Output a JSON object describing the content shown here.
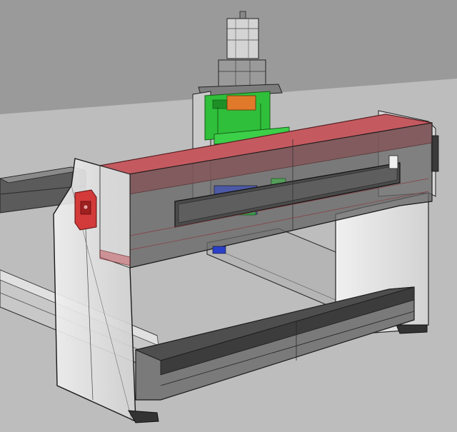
{
  "viewport": {
    "background": "#9a9a9a",
    "ground_plane_color": "#bdbdbd",
    "render_mode": "ghosted"
  },
  "model": {
    "parts": [
      {
        "name": "gantry-beam",
        "color": "#b84a50"
      },
      {
        "name": "z-axis-carriage",
        "color": "#2fbf3a"
      },
      {
        "name": "stepper-motor",
        "color": "#cfcfcf"
      },
      {
        "name": "spindle-mount",
        "color": "#e07a2a"
      },
      {
        "name": "drive-plate",
        "color": "#2a3fc8"
      },
      {
        "name": "limit-switch",
        "color": "#d33a3a"
      },
      {
        "name": "side-plate-left",
        "color": "#e6e6e6"
      },
      {
        "name": "side-plate-right",
        "color": "#e6e6e6"
      },
      {
        "name": "base-rail-front",
        "color": "#4a4a4a"
      },
      {
        "name": "base-rail-left",
        "color": "#4a4a4a"
      }
    ]
  }
}
